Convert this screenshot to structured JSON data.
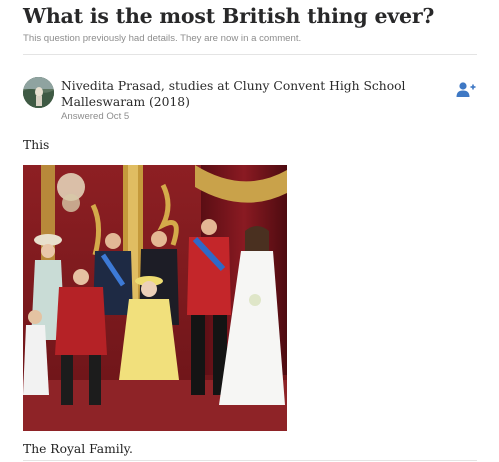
{
  "question": {
    "title": "What is the most British thing ever?",
    "note": "This question previously had details. They are now in a comment."
  },
  "answer": {
    "author_line": "Nivedita Prasad, studies at Cluny Convent High School Malleswaram (2018)",
    "date": "Answered Oct 5",
    "paragraphs": [
      "This",
      "The Royal Family."
    ],
    "follow_icon": "add-user-icon",
    "avatar_icon": "avatar-photo"
  },
  "colors": {
    "title": "#282829",
    "meta": "#8d8d8d",
    "follow_icon": "#3e78c4",
    "divider": "#e4e4e4"
  }
}
